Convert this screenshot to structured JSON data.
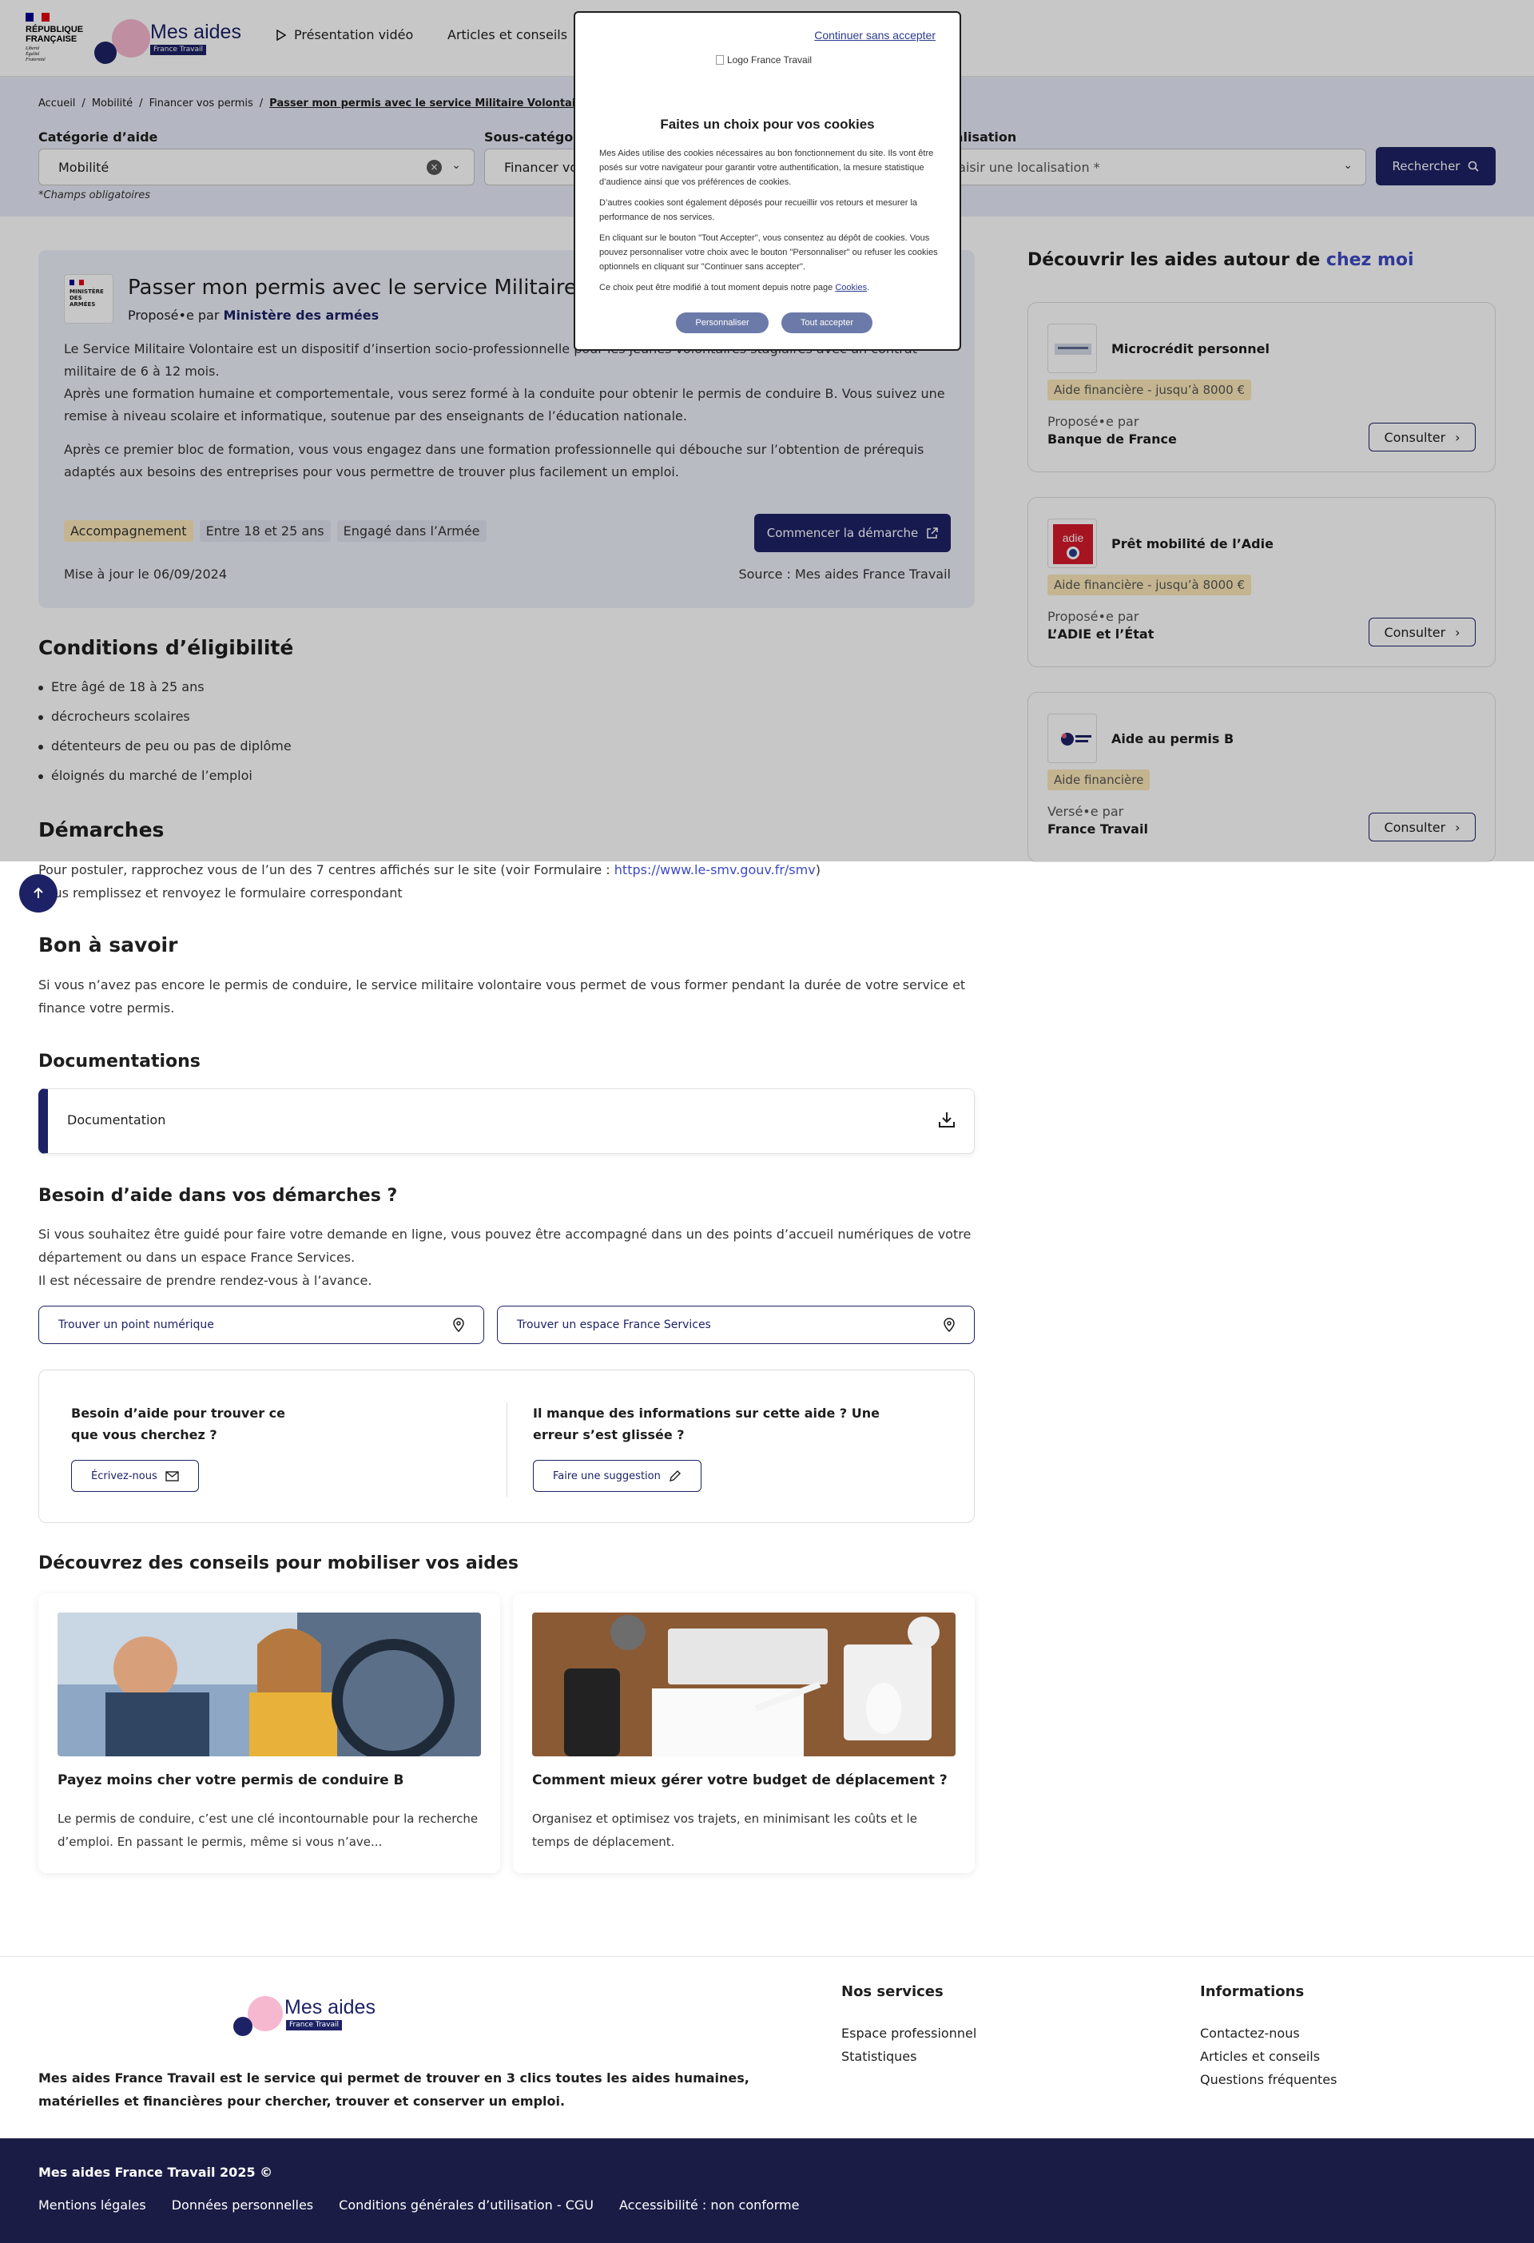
{
  "header": {
    "marianne": {
      "rf_line1": "RÉPUBLIQUE",
      "rf_line2": "FRANÇAISE",
      "devise": [
        "Liberté",
        "Égalité",
        "Fraternité"
      ]
    },
    "logo": {
      "title": "Mes aides",
      "subtitle": "France Travail"
    },
    "nav": {
      "video": "Présentation vidéo",
      "articles": "Articles et conseils"
    }
  },
  "breadcrumb": [
    "Accueil",
    "/",
    "Mobilité",
    "/",
    "Financer vos permis",
    "/",
    "Passer mon permis avec le service Militaire Volontaire"
  ],
  "search": {
    "category_label": "Catégorie d’aide",
    "category_value": "Mobilité",
    "subcategory_label": "Sous-catégorie",
    "subcategory_value": "Financer vos permis",
    "location_label": "Localisation",
    "location_placeholder": "Saisir une localisation *",
    "search_button": "Rechercher",
    "required_note": "*Champs obligatoires"
  },
  "aid": {
    "org_logo_text": "MINISTÈRE DES ARMÉES",
    "title": "Passer mon permis avec le service Militaire Volontaire",
    "proposed_by_label": "Proposé•e par",
    "proposed_by": "Ministère des armées",
    "description": [
      "Le Service Militaire Volontaire est un dispositif d’insertion socio-professionnelle pour les jeunes volontaires stagiaires avec un contrat militaire de 6 à 12 mois.\nAprès une formation humaine et comportementale, vous serez formé à la conduite pour obtenir le permis de conduire B. Vous suivez une remise à niveau scolaire et informatique, soutenue par des enseignants de l’éducation nationale.",
      "Après ce premier bloc de formation, vous vous engagez dans une formation professionnelle qui débouche sur l’obtention de prérequis adaptés aux besoins des entreprises pour vous permettre de trouver plus facilement un emploi."
    ],
    "tags": [
      "Accompagnement",
      "Entre 18 et 25 ans",
      "Engagé dans l’Armée"
    ],
    "start_button": "Commencer la démarche",
    "updated": "Mise à jour le 06/09/2024",
    "source": "Source : Mes aides France Travail"
  },
  "eligibility": {
    "title": "Conditions d’éligibilité",
    "items": [
      "Etre âgé de 18 à 25 ans",
      "décrocheurs scolaires",
      "détenteurs de peu ou pas de diplôme",
      "éloignés du marché de l’emploi"
    ]
  },
  "demarches": {
    "title": "Démarches",
    "line1_prefix": "Pour postuler, rapprochez vous de l’un des 7 centres affichés sur le site (voir Formulaire : ",
    "line1_link": "https://www.le-smv.gouv.fr/smv",
    "line1_suffix": ")",
    "line2": "Vous remplissez et renvoyez le formulaire correspondant"
  },
  "good_to_know": {
    "title": "Bon à savoir",
    "text": "Si vous n’avez pas encore le permis de conduire, le service militaire volontaire vous permet de vous former pendant la durée de votre service et finance votre permis."
  },
  "documentation": {
    "title": "Documentations",
    "item": "Documentation"
  },
  "help": {
    "title": "Besoin d’aide dans vos démarches ?",
    "text": "Si vous souhaitez être guidé pour faire votre demande en ligne, vous pouvez être accompagné dans un des points d’accueil numériques de votre département ou dans un espace France Services.\nIl est nécessaire de prendre rendez-vous à l’avance.",
    "btn_numeric": "Trouver un point numérique",
    "btn_fs": "Trouver un espace France Services",
    "box_q1": "Besoin d’aide pour trouver ce que vous cherchez ?",
    "box_btn1": "Écrivez-nous",
    "box_q2": "Il manque des informations sur cette aide ? Une erreur s’est glissée ?",
    "box_btn2": "Faire une suggestion"
  },
  "articles": {
    "title": "Découvrez des conseils pour mobiliser vos aides",
    "items": [
      {
        "title": "Payez moins cher votre permis de conduire B",
        "desc": "Le permis de conduire, c’est une clé incontournable pour la recherche d’emploi. En passant le permis, même si vous n’ave..."
      },
      {
        "title": "Comment mieux gérer votre budget de déplacement ?",
        "desc": "Organisez et optimisez vos trajets, en minimisant les coûts et le temps de déplacement."
      }
    ]
  },
  "sidebar": {
    "title_prefix": "Découvrir les aides autour de ",
    "title_highlight": "chez moi",
    "cards": [
      {
        "title": "Microcrédit personnel",
        "badge": "Aide financière - jusqu’à 8000 €",
        "prop_label": "Proposé•e par",
        "prop": "Banque de France",
        "button": "Consulter"
      },
      {
        "title": "Prêt mobilité de l’Adie",
        "badge": "Aide financière - jusqu’à 8000 €",
        "prop_label": "Proposé•e par",
        "prop": "L’ADIE et l’État",
        "button": "Consulter"
      },
      {
        "title": "Aide au permis B",
        "badge": "Aide financière",
        "prop_label": "Versé•e par",
        "prop": "France Travail",
        "button": "Consulter"
      }
    ]
  },
  "cookie": {
    "skip": "Continuer sans accepter",
    "logo_alt": "Logo France Travail",
    "title": "Faites un choix pour vos cookies",
    "p1": "Mes Aides utilise des cookies nécessaires au bon fonctionnement du site. Ils vont être posés sur votre navigateur pour garantir votre authentification, la mesure statistique d’audience ainsi que vos préférences de cookies.",
    "p2": "D’autres cookies sont également déposés pour recueillir vos retours et mesurer la performance de nos services.",
    "p3": "En cliquant sur le bouton \"Tout Accepter\", vous consentez au dépôt de cookies. Vous pouvez personnaliser votre choix avec le bouton \"Personnaliser\" ou refuser les cookies optionnels en cliquant sur \"Continuer sans accepter\".",
    "p4_prefix": "Ce choix peut être modifié à tout moment depuis notre page ",
    "p4_link": "Cookies",
    "p4_suffix": ".",
    "btn_custom": "Personnaliser",
    "btn_accept": "Tout accepter"
  },
  "footer": {
    "description": "Mes aides France Travail est le service qui permet de trouver en 3 clics toutes les aides humaines, matérielles et financières pour chercher, trouver et conserver un emploi.",
    "services_title": "Nos services",
    "services": [
      "Espace professionnel",
      "Statistiques"
    ],
    "info_title": "Informations",
    "info": [
      "Contactez-nous",
      "Articles et conseils",
      "Questions fréquentes"
    ],
    "copyright": "Mes aides France Travail 2025 ©",
    "legal": [
      "Mentions légales",
      "Données personnelles",
      "Conditions générales d’utilisation - CGU",
      "Accessibilité : non conforme"
    ]
  },
  "colors": {
    "primary": "#1d2266",
    "band": "#e7eaf8",
    "card": "#eef0fa",
    "badge": "#fbe8b9",
    "link": "#3d49c4",
    "footer": "#1a1c45"
  }
}
